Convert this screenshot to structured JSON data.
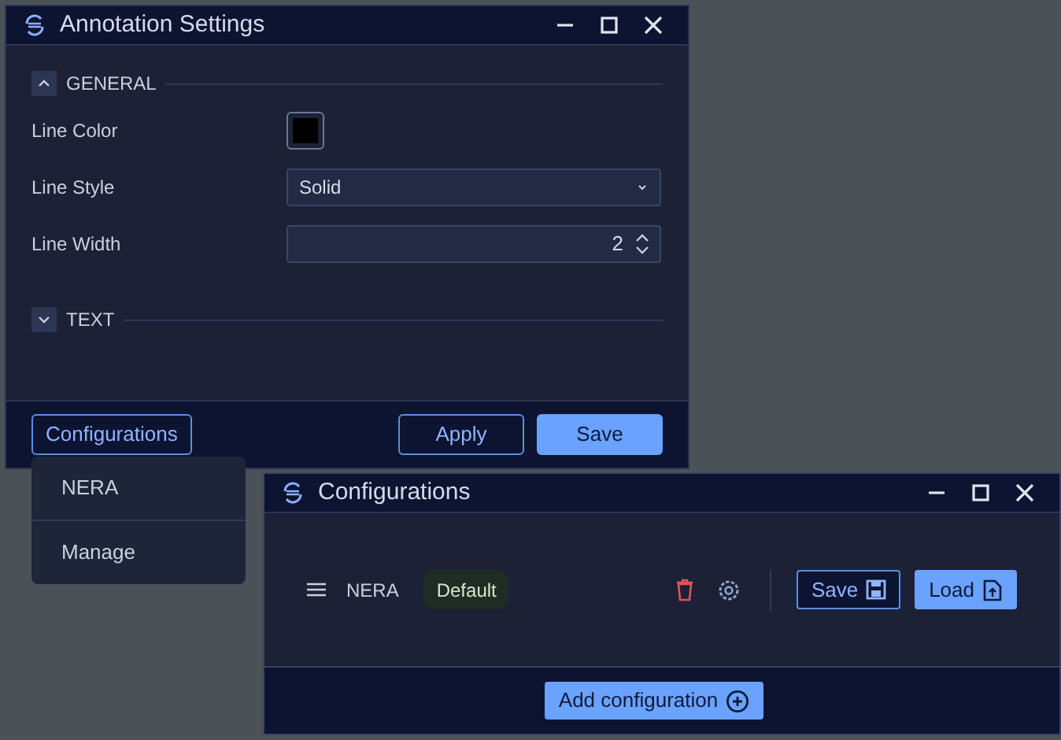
{
  "annotation_window": {
    "title": "Annotation Settings",
    "sections": [
      {
        "label": "GENERAL",
        "expanded": true,
        "fields": [
          {
            "kind": "color",
            "label": "Line Color",
            "color": "#000000"
          },
          {
            "kind": "select",
            "label": "Line Style",
            "value": "Solid"
          },
          {
            "kind": "number",
            "label": "Line Width",
            "value": "2"
          }
        ]
      },
      {
        "label": "TEXT",
        "expanded": false
      }
    ],
    "menu_button": "Configurations",
    "buttons": [
      {
        "label": "Apply",
        "kind": "outline"
      },
      {
        "label": "Save",
        "kind": "primary"
      }
    ]
  },
  "dropdown_menu": {
    "items": [
      "NERA",
      "Manage"
    ]
  },
  "configurations_window": {
    "title": "Configurations",
    "rows": [
      {
        "name": "NERA",
        "badge": "Default",
        "buttons": [
          {
            "label": "Save",
            "kind": "outline"
          },
          {
            "label": "Load",
            "kind": "primary"
          }
        ]
      }
    ],
    "add_button": "Add configuration"
  }
}
